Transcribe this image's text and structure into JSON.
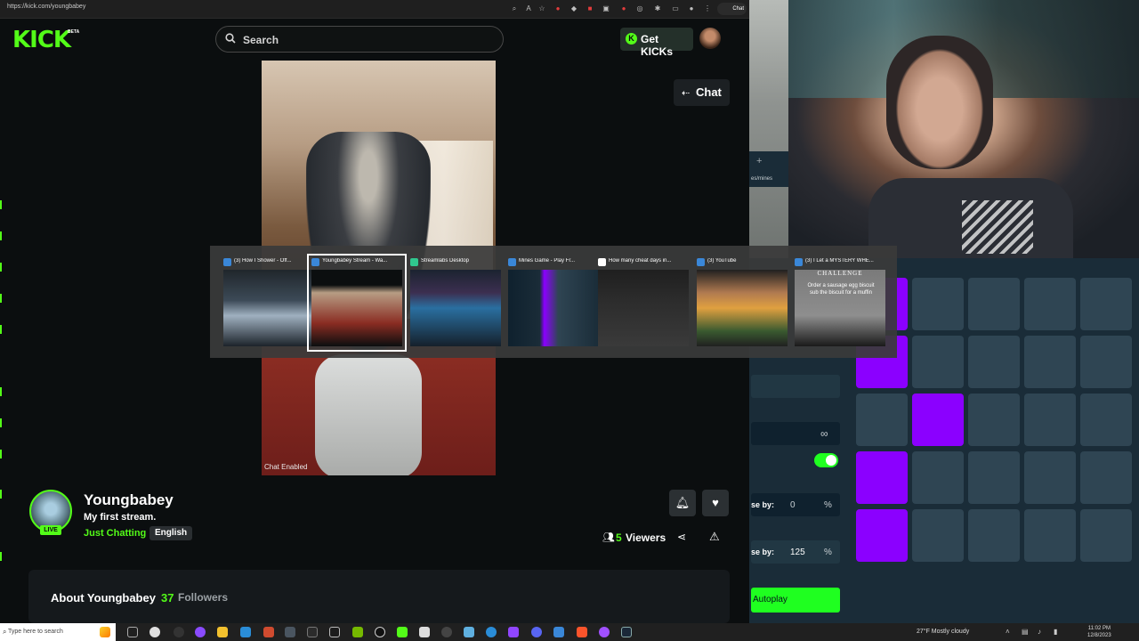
{
  "browser": {
    "url": "https://kick.com/youngbabey"
  },
  "header": {
    "logo": "KICK",
    "logo_badge": "BETA",
    "search_placeholder": "Search",
    "get_kicks_label": "Get KICKs"
  },
  "player": {
    "chat_enabled": "Chat Enabled",
    "chat_button_label": "Chat"
  },
  "channel": {
    "name": "Youngbabey",
    "live_badge": "LIVE",
    "title": "My first stream.",
    "category": "Just Chatting",
    "language": "English",
    "viewers_count": "5",
    "viewers_label": "Viewers",
    "about_title": "About Youngbabey",
    "followers_count": "37",
    "followers_label": "Followers"
  },
  "switcher": {
    "windows": [
      {
        "title": "(3) How I Shower - Off...",
        "icon_color": "#3a87d8",
        "active": false
      },
      {
        "title": "Youngbabey Stream - Wa...",
        "icon_color": "#3a87d8",
        "active": true
      },
      {
        "title": "Streamlabs Desktop",
        "icon_color": "#30c78e",
        "active": false
      },
      {
        "title": "Mines Game - Play Fr...",
        "icon_color": "#3a87d8",
        "active": false
      },
      {
        "title": "How many cheat days in...",
        "icon_color": "#ffffff",
        "active": false
      },
      {
        "title": "(3) YouTube",
        "icon_color": "#3a87d8",
        "active": false
      },
      {
        "title": "(3) I Let a MYSTERY WHE...",
        "icon_color": "#3a87d8",
        "active": false
      }
    ],
    "challenge_title": "CHALLENGE",
    "challenge_text": "Order a sausage egg biscuit sub the biscuit for a muffin"
  },
  "game": {
    "url_fragment": "es/mines",
    "on_win_label": "se by:",
    "on_win_value": "0",
    "on_loss_label": "se by:",
    "on_loss_value": "125",
    "percent_symbol": "%",
    "autoplay_label": "Autoplay",
    "grid": [
      [
        1,
        0,
        0,
        0,
        0
      ],
      [
        1,
        0,
        0,
        0,
        0
      ],
      [
        0,
        1,
        0,
        0,
        0
      ],
      [
        1,
        0,
        0,
        0,
        0
      ],
      [
        1,
        0,
        0,
        0,
        0
      ]
    ]
  },
  "taskbar": {
    "search_placeholder": "Type here to search",
    "weather": "27°F  Mostly cloudy",
    "time": "11:02 PM",
    "date": "12/8/2023"
  },
  "colors": {
    "kick_green": "#53fc18",
    "gem_purple": "#8b00ff",
    "tile_gray": "#2f4553",
    "autoplay_green": "#1fff20"
  }
}
